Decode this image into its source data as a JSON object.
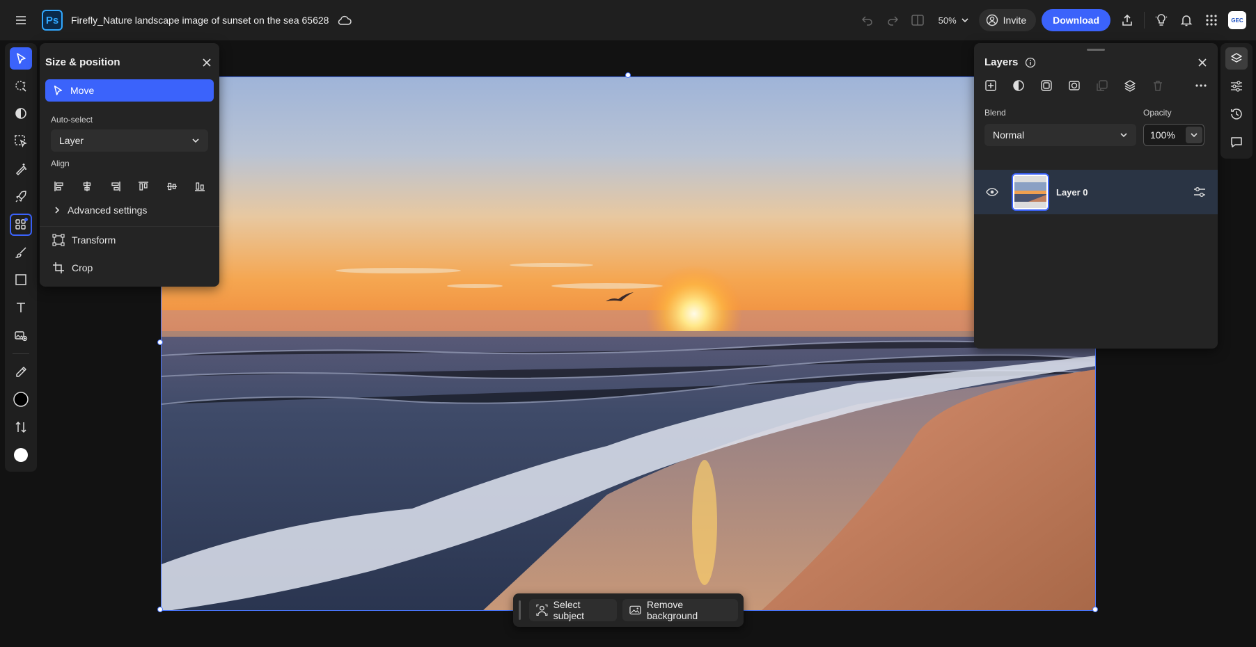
{
  "header": {
    "app_logo": "Ps",
    "document_title": "Firefly_Nature landscape image of sunset on the sea 65628",
    "zoom": "50%",
    "invite_label": "Invite",
    "download_label": "Download",
    "avatar_text": "GEC"
  },
  "tools": [
    "select-icon",
    "quick-select-icon",
    "adjust-icon",
    "select-area-icon",
    "retouch-icon",
    "quick-actions-icon",
    "size-position-icon",
    "brush-icon",
    "shape-icon",
    "text-icon",
    "generative-fill-icon",
    "eyedropper-icon",
    "foreground-color",
    "swap-colors-icon",
    "background-color"
  ],
  "size_position_panel": {
    "title": "Size & position",
    "move_label": "Move",
    "auto_select_label": "Auto-select",
    "auto_select_value": "Layer",
    "align_label": "Align",
    "advanced_label": "Advanced settings",
    "transform_label": "Transform",
    "crop_label": "Crop"
  },
  "layers_panel": {
    "title": "Layers",
    "blend_label": "Blend",
    "blend_value": "Normal",
    "opacity_label": "Opacity",
    "opacity_value": "100%",
    "layers": [
      {
        "name": "Layer 0",
        "visible": true,
        "selected": true
      }
    ]
  },
  "context_bar": {
    "select_subject_label": "Select subject",
    "remove_background_label": "Remove background"
  },
  "colors": {
    "accent": "#3b63fb",
    "foreground_color": "#000000",
    "background_color": "#ffffff"
  }
}
